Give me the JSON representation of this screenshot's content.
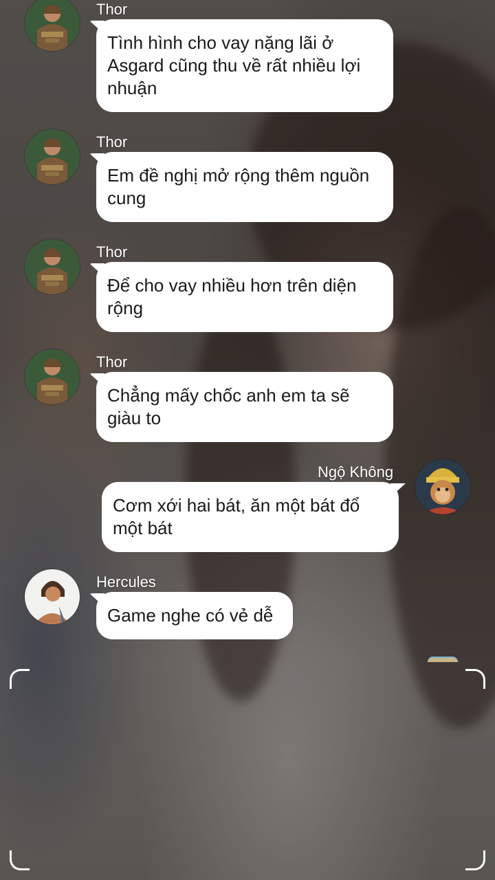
{
  "messages": [
    {
      "sender": "Thor",
      "text": "Tình hình cho vay nặng lãi ở Asgard cũng thu về rất nhiều lợi nhuận",
      "side": "left",
      "avatar": "thor-avatar"
    },
    {
      "sender": "Thor",
      "text": "Em đề nghị mở rộng thêm nguồn cung",
      "side": "left",
      "avatar": "thor-avatar"
    },
    {
      "sender": "Thor",
      "text": "Để cho vay nhiều hơn trên diện rộng",
      "side": "left",
      "avatar": "thor-avatar"
    },
    {
      "sender": "Thor",
      "text": "Chẳng mấy chốc anh em ta sẽ giàu to",
      "side": "left",
      "avatar": "thor-avatar"
    },
    {
      "sender": "Ngộ Không",
      "text": "Cơm xới hai bát, ăn một bát đổ một bát",
      "side": "right",
      "avatar": "sun-wukong-avatar"
    },
    {
      "sender": "Hercules",
      "text": "Game nghe có vẻ dễ",
      "side": "left",
      "avatar": "hercules-avatar"
    }
  ],
  "colors": {
    "bubble": "#ffffff",
    "text": "#1a1a1a",
    "name": "#ffffff"
  },
  "overlay": {
    "corner_icon": "viewfinder-corner-icon"
  }
}
